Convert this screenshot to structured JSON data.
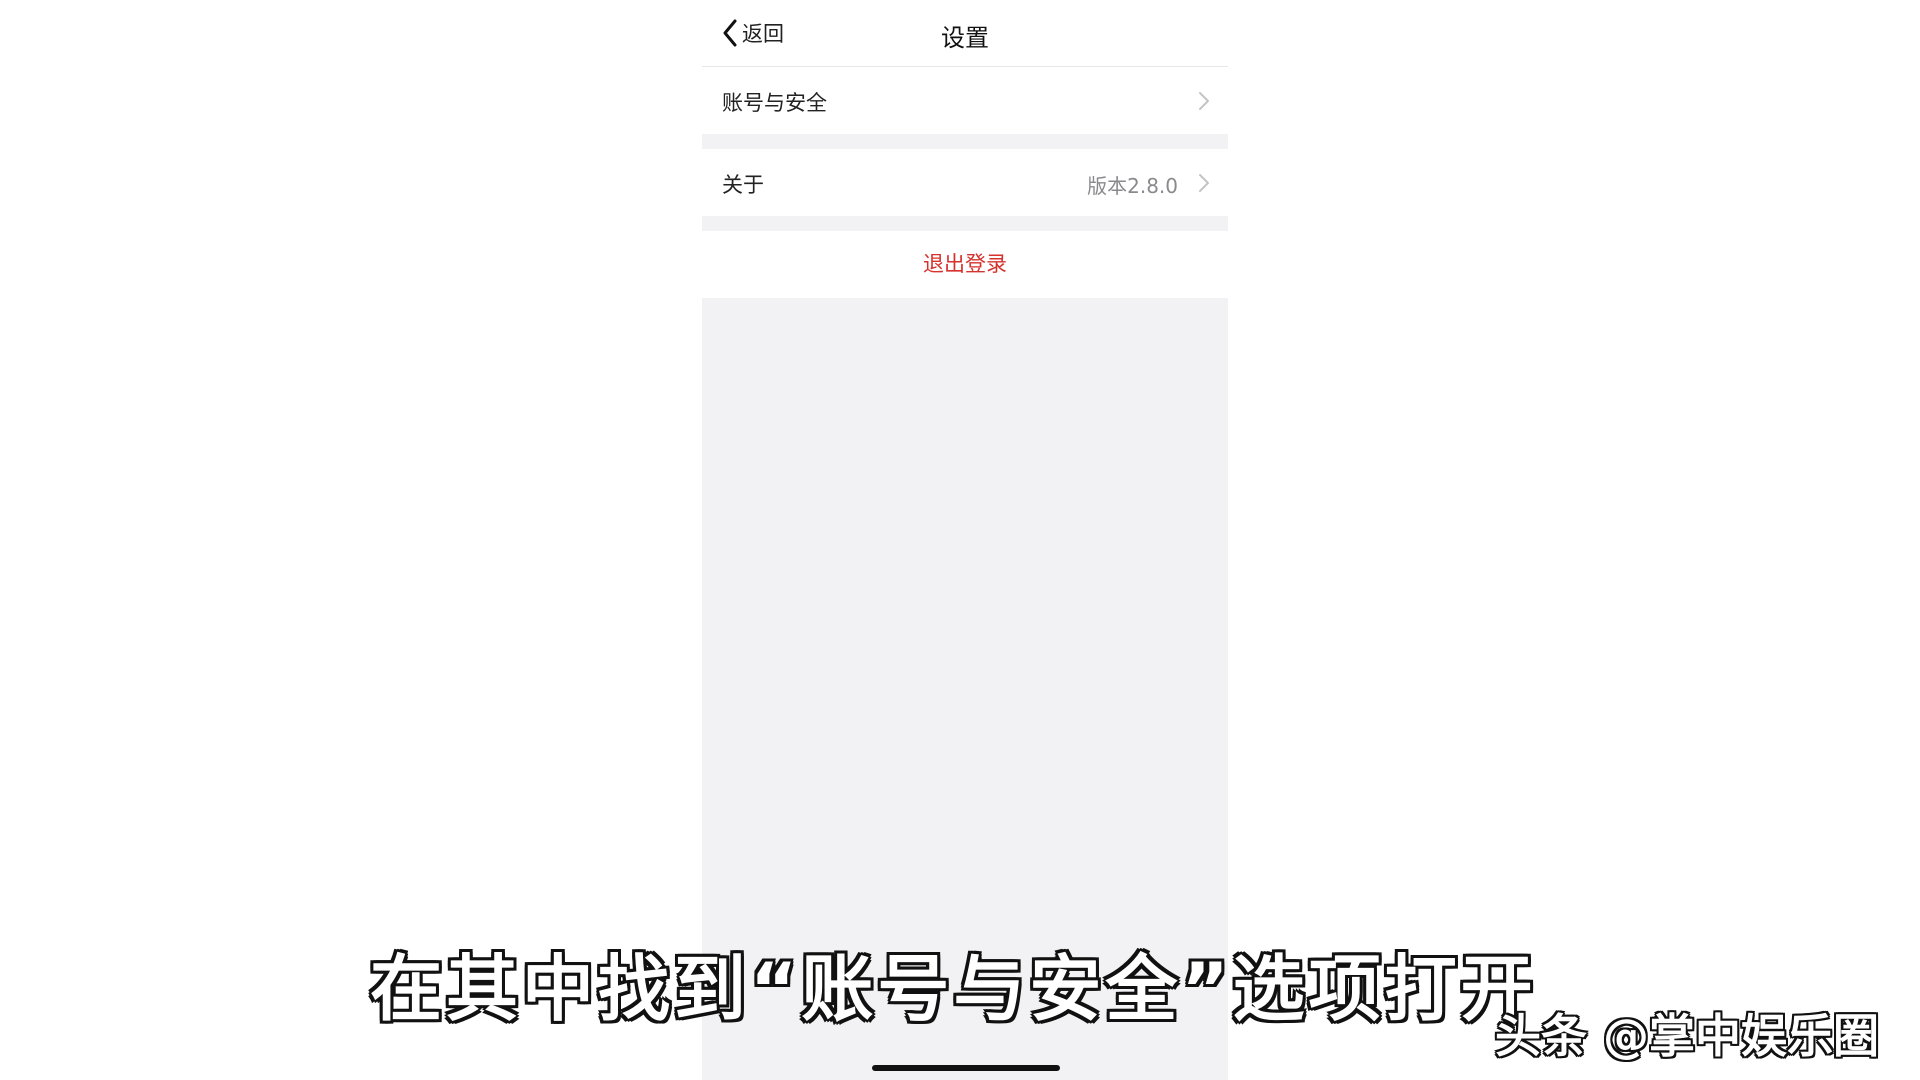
{
  "navbar": {
    "back_label": "返回",
    "title": "设置"
  },
  "settings": [
    {
      "label": "账号与安全",
      "value": ""
    },
    {
      "label": "关于",
      "value": "版本2.8.0"
    }
  ],
  "logout_label": "退出登录",
  "caption": "在其中找到“账号与安全”选项打开",
  "watermark": "头条 @掌中娱乐圈",
  "colors": {
    "logout_text": "#d6322e",
    "page_background": "#f2f1f4"
  }
}
